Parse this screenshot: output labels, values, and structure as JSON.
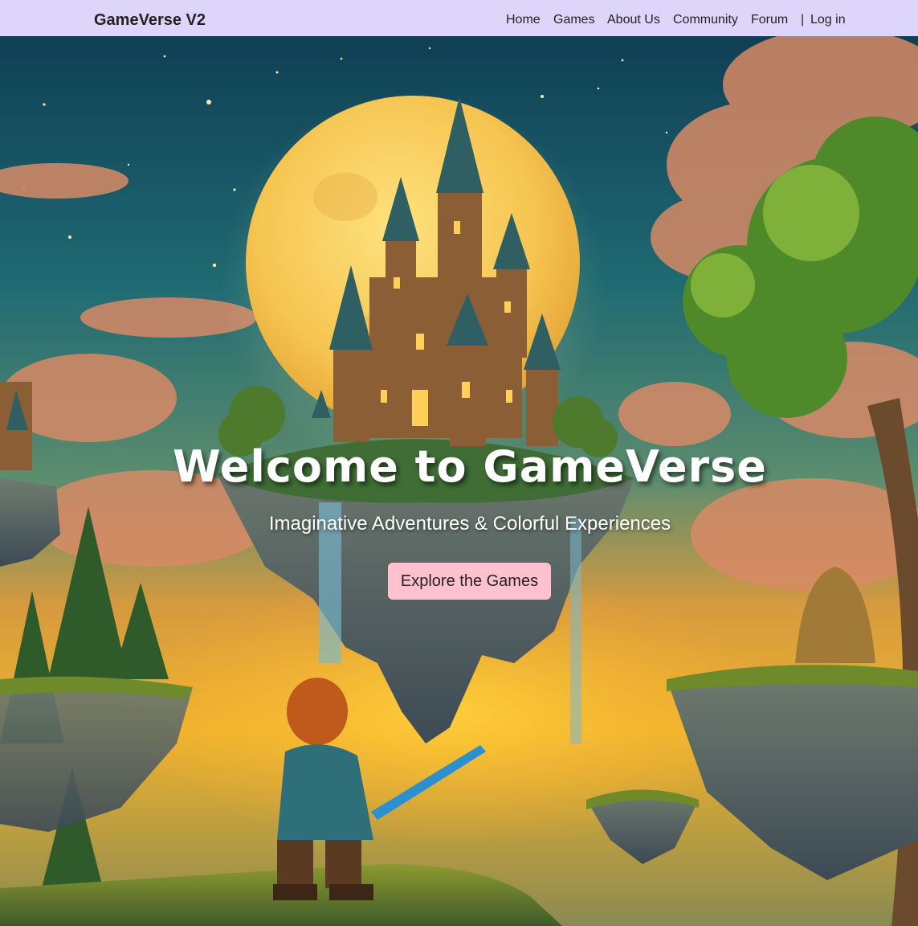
{
  "navbar": {
    "brand": "GameVerse V2",
    "links": {
      "home": "Home",
      "games": "Games",
      "about": "About Us",
      "community": "Community",
      "forum": "Forum"
    },
    "separator": "|",
    "login": "Log in",
    "background": "#ded6fa"
  },
  "hero": {
    "title": "Welcome to GameVerse",
    "subtitle": "Imaginative Adventures & Colorful Experiences",
    "cta_label": "Explore the Games",
    "cta_color": "#ffc0d0"
  }
}
